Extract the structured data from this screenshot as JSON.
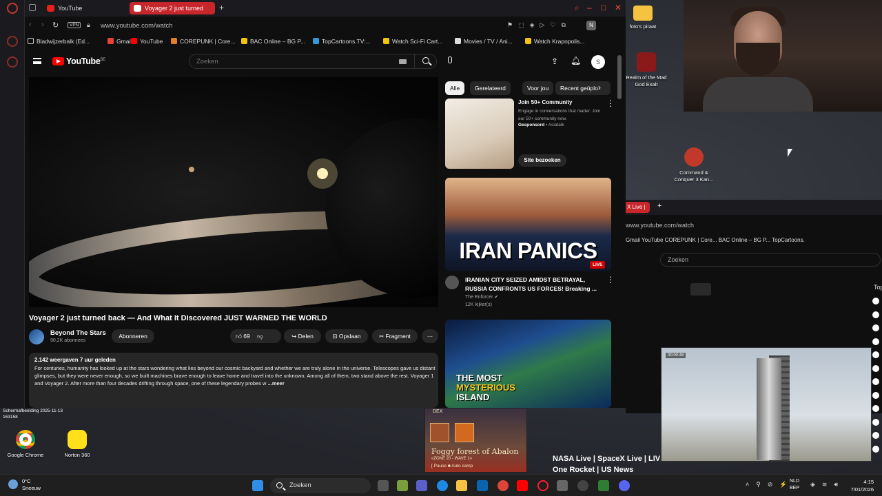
{
  "browser": {
    "tabs": [
      {
        "label": "YouTube"
      },
      {
        "label": "Voyager 2 just turned"
      }
    ],
    "url": "www.youtube.com/watch",
    "vpn_label": "VPN",
    "bookmarks": [
      "Bladwijzerbalk (Ed...",
      "Gmail",
      "YouTube",
      "COREPUNK | Core...",
      "BAC Online – BG P...",
      "TopCartoons.TV:...",
      "Watch Sci-Fi Cart...",
      "Movies / TV / Ani...",
      "Watch Krapopolis..."
    ]
  },
  "youtube": {
    "logo_text": "YouTube",
    "country": "BE",
    "search_placeholder": "Zoeken",
    "avatar_letter": "S",
    "video": {
      "title": "Voyager 2 just turned back — And What It Discovered JUST WARNED THE WORLD",
      "channel": "Beyond The Stars",
      "subscribers": "90,2K abonnees",
      "subscribe_label": "Abonneren",
      "likes": "69",
      "share_label": "Delen",
      "save_label": "Opslaan",
      "clip_label": "Fragment",
      "meta": "2.142 weergaven  7 uur geleden",
      "description": "For centuries, humanity has looked up at the stars wondering what lies beyond our cosmic backyard and whether we are truly alone in the universe. Telescopes gave us distant glimpses, but they were never enough, so we built machines brave enough to leave home and travel into the unknown. Among all of them, two stand above the rest. Voyager 1 and Voyager 2. After more than four decades drifting through space, one of these legendary probes w",
      "more_label": "...meer"
    },
    "chips": [
      "Alle",
      "Gerelateerd",
      "Voor jou",
      "Recent geüplo"
    ],
    "ad": {
      "title": "Join 50+ Community",
      "text": "Engage in conversations that matter. Join our 50+ community now.",
      "sponsored": "Gesponsord",
      "advertiser": "Asiatalk",
      "cta": "Site bezoeken"
    },
    "rec1": {
      "thumb_text": "IRAN PANICS",
      "live_badge": "LIVE",
      "title": "IRANIAN CITY SEIZED AMIDST BETRAYAL, RUSSIA CONFRONTS US FORCES! Breaking ...",
      "channel": "The Enforcer",
      "viewers": "12K kijker(s)"
    },
    "rec2": {
      "thumb_text_1": "THE MOST",
      "thumb_text_2": "MYSTERIOUS",
      "thumb_text_3": "ISLAND"
    }
  },
  "desktop": {
    "icons": [
      {
        "label": "foto's piraat"
      },
      {
        "label": "Realm of the Mad God Exalt"
      },
      {
        "label": "Command & Conquer 3 Kan..."
      },
      {
        "label": "Google Chrome"
      },
      {
        "label": "Norton 360"
      }
    ],
    "screenshot_label": "Schermafbeelding 2025-11-13 163158"
  },
  "browser2": {
    "tab_label": "X Live |",
    "url": "www.youtube.com/watch",
    "bookmarks": "Gmail   YouTube   COREPUNK | Core...   BAC Online – BG P...   TopCartoons.",
    "search_placeholder": "Zoeken",
    "miniplayer_time": "00:00:48",
    "video_title": "NASA Live | SpaceX Live | LIV\nOne Rocket | US News",
    "partial_label": "Top"
  },
  "game": {
    "badge": "DEX",
    "title": "Foggy forest of Abalon",
    "subtitle": "«ZONE 20 - WAVE 1»",
    "pause": "[ Pause        ■ Auto camp"
  },
  "taskbar": {
    "weather_temp": "0°C",
    "weather_text": "Sneeuw",
    "search_label": "Zoeken",
    "lang_1": "NLD",
    "lang_2": "BEP",
    "time": "4:15",
    "date": "7/01/2026"
  }
}
